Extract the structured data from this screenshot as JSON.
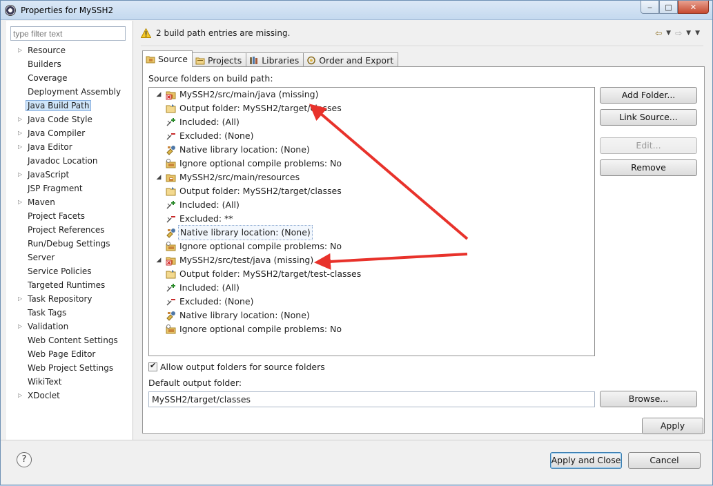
{
  "window": {
    "title": "Properties for MySSH2",
    "minimize": "‒",
    "maximize": "□",
    "close": "✕"
  },
  "filter": {
    "placeholder": "type filter text"
  },
  "nav": [
    {
      "label": "Resource",
      "expandable": true
    },
    {
      "label": "Builders"
    },
    {
      "label": "Coverage"
    },
    {
      "label": "Deployment Assembly"
    },
    {
      "label": "Java Build Path",
      "selected": true
    },
    {
      "label": "Java Code Style",
      "expandable": true
    },
    {
      "label": "Java Compiler",
      "expandable": true
    },
    {
      "label": "Java Editor",
      "expandable": true
    },
    {
      "label": "Javadoc Location"
    },
    {
      "label": "JavaScript",
      "expandable": true
    },
    {
      "label": "JSP Fragment"
    },
    {
      "label": "Maven",
      "expandable": true
    },
    {
      "label": "Project Facets"
    },
    {
      "label": "Project References"
    },
    {
      "label": "Run/Debug Settings"
    },
    {
      "label": "Server"
    },
    {
      "label": "Service Policies"
    },
    {
      "label": "Targeted Runtimes"
    },
    {
      "label": "Task Repository",
      "expandable": true
    },
    {
      "label": "Task Tags"
    },
    {
      "label": "Validation",
      "expandable": true
    },
    {
      "label": "Web Content Settings"
    },
    {
      "label": "Web Page Editor"
    },
    {
      "label": "Web Project Settings"
    },
    {
      "label": "WikiText"
    },
    {
      "label": "XDoclet",
      "expandable": true
    }
  ],
  "message": {
    "text": "2 build path entries are missing."
  },
  "tabs": [
    "Source",
    "Projects",
    "Libraries",
    "Order and Export"
  ],
  "source": {
    "section_label": "Source folders on build path:",
    "tree": [
      {
        "level": 0,
        "label": "MySSH2/src/main/java (missing)",
        "icon": "missing-source-folder-icon"
      },
      {
        "level": 1,
        "label": "Output folder: MySSH2/target/classes",
        "icon": "output-folder-icon"
      },
      {
        "level": 1,
        "label": "Included: (All)",
        "icon": "inclusion-filter-icon"
      },
      {
        "level": 1,
        "label": "Excluded: (None)",
        "icon": "exclusion-filter-icon"
      },
      {
        "level": 1,
        "label": "Native library location: (None)",
        "icon": "native-library-icon"
      },
      {
        "level": 1,
        "label": "Ignore optional compile problems: No",
        "icon": "ignore-problems-icon"
      },
      {
        "level": 0,
        "label": "MySSH2/src/main/resources",
        "icon": "source-folder-icon"
      },
      {
        "level": 1,
        "label": "Output folder: MySSH2/target/classes",
        "icon": "output-folder-icon"
      },
      {
        "level": 1,
        "label": "Included: (All)",
        "icon": "inclusion-filter-icon"
      },
      {
        "level": 1,
        "label": "Excluded: **",
        "icon": "exclusion-filter-icon"
      },
      {
        "level": 1,
        "label": "Native library location: (None)",
        "icon": "native-library-icon",
        "focused": true
      },
      {
        "level": 1,
        "label": "Ignore optional compile problems: No",
        "icon": "ignore-problems-icon"
      },
      {
        "level": 0,
        "label": "MySSH2/src/test/java (missing)",
        "icon": "missing-source-folder-icon"
      },
      {
        "level": 1,
        "label": "Output folder: MySSH2/target/test-classes",
        "icon": "output-folder-icon"
      },
      {
        "level": 1,
        "label": "Included: (All)",
        "icon": "inclusion-filter-icon"
      },
      {
        "level": 1,
        "label": "Excluded: (None)",
        "icon": "exclusion-filter-icon"
      },
      {
        "level": 1,
        "label": "Native library location: (None)",
        "icon": "native-library-icon"
      },
      {
        "level": 1,
        "label": "Ignore optional compile problems: No",
        "icon": "ignore-problems-icon"
      }
    ],
    "buttons": {
      "add_folder": "Add Folder...",
      "link_source": "Link Source...",
      "edit": "Edit...",
      "remove": "Remove",
      "browse": "Browse..."
    },
    "allow_output_folders": {
      "label": "Allow output folders for source folders",
      "checked": true
    },
    "default_output_label": "Default output folder:",
    "default_output_value": "MySSH2/target/classes"
  },
  "footer": {
    "apply": "Apply",
    "apply_close": "Apply and Close",
    "cancel": "Cancel",
    "help": "?"
  },
  "colors": {
    "annotation_arrow": "#e8322b",
    "selection": "#cfe5fa",
    "title_bar": "#c4d9ef"
  }
}
